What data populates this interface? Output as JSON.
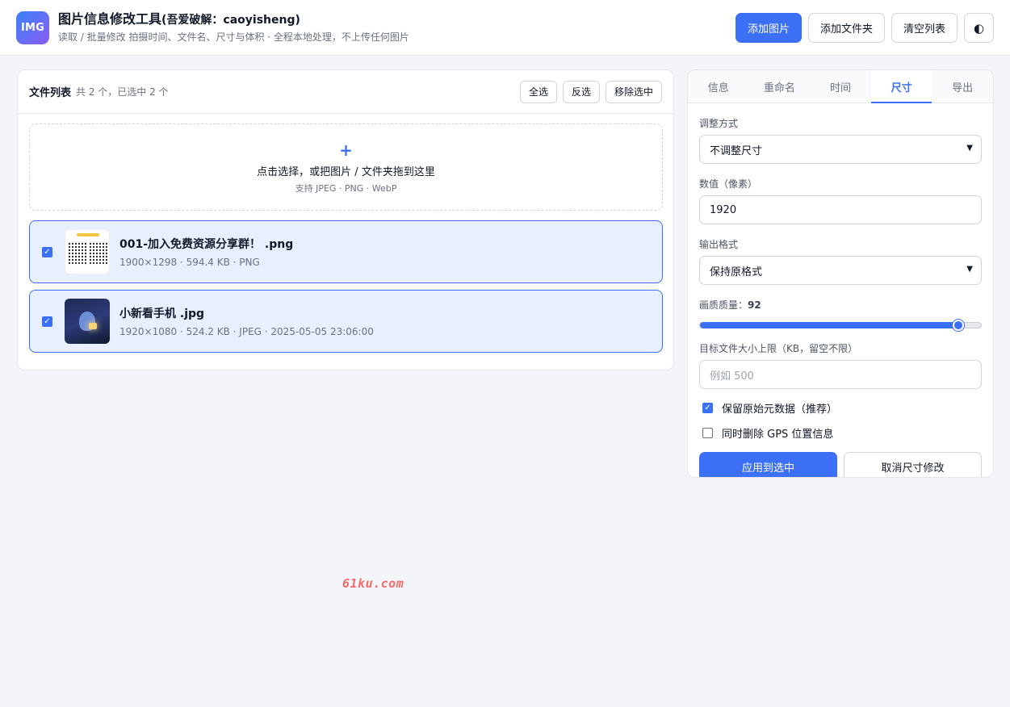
{
  "header": {
    "logo": "IMG",
    "title": "图片信息修改工具",
    "title_suffix": "(吾爱破解：caoyisheng)",
    "subtitle": "读取 / 批量修改 拍摄时间、文件名、尺寸与体积 · 全程本地处理，不上传任何图片",
    "add_image_label": "添加图片",
    "add_folder_label": "添加文件夹",
    "clear_list_label": "清空列表",
    "theme_toggle_glyph": "◐"
  },
  "file_list": {
    "title": "文件列表",
    "count_text": "共 2 个，已选中 2 个",
    "select_all_label": "全选",
    "invert_label": "反选",
    "remove_selected_label": "移除选中",
    "dropzone": {
      "plus": "+",
      "main_text": "点击选择，或把图片 / 文件夹拖到这里",
      "sub_text": "支持 JPEG · PNG · WebP"
    },
    "items": [
      {
        "name": "001-加入免费资源分享群！ .png",
        "meta": "1900×1298 · 594.4 KB · PNG",
        "checked": true,
        "thumb_icon": "qr-code-thumbnail"
      },
      {
        "name": "小新看手机 .jpg",
        "meta": "1920×1080 · 524.2 KB · JPEG · 2025-05-05 23:06:00",
        "checked": true,
        "thumb_icon": "night-scene-thumbnail"
      }
    ]
  },
  "settings": {
    "tabs": [
      {
        "label": "信息",
        "active": false
      },
      {
        "label": "重命名",
        "active": false
      },
      {
        "label": "时间",
        "active": false
      },
      {
        "label": "尺寸",
        "active": true
      },
      {
        "label": "导出",
        "active": false
      }
    ],
    "resize_mode_label": "调整方式",
    "resize_mode_value": "不调整尺寸",
    "pixel_value_label": "数值（像素）",
    "pixel_value": "1920",
    "output_format_label": "输出格式",
    "output_format_value": "保持原格式",
    "quality_label": "画质质量：",
    "quality_value": "92",
    "quality_fraction": 0.92,
    "target_size_label": "目标文件大小上限（KB，留空不限）",
    "target_size_placeholder": "例如 500",
    "keep_metadata_label": "保留原始元数据（推荐）",
    "keep_metadata_checked": true,
    "remove_gps_label": "同时删除 GPS 位置信息",
    "remove_gps_checked": false,
    "apply_label": "应用到选中",
    "cancel_label": "取消尺寸修改"
  },
  "watermark": "61ku.com",
  "colors": {
    "accent": "#3b6ff5",
    "selected_row_bg": "#e8efff",
    "watermark": "#f26b6b"
  }
}
